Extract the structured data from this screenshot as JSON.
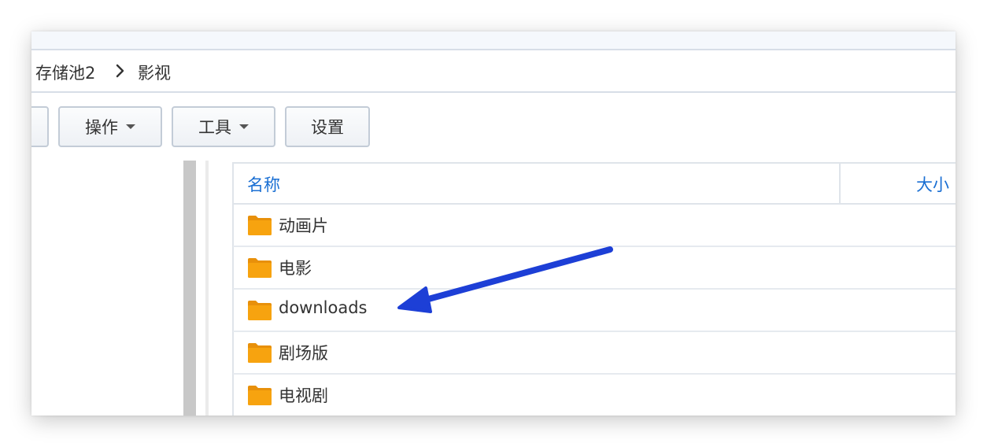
{
  "breadcrumb": {
    "items": [
      "存储池2",
      "影视"
    ]
  },
  "toolbar": {
    "actions_label": "操作",
    "tools_label": "工具",
    "settings_label": "设置"
  },
  "file_list": {
    "columns": {
      "name": "名称",
      "size": "大小"
    },
    "rows": [
      {
        "name": "动画片",
        "type": "folder"
      },
      {
        "name": "电影",
        "type": "folder"
      },
      {
        "name": "downloads",
        "type": "folder"
      },
      {
        "name": "剧场版",
        "type": "folder"
      },
      {
        "name": "电视剧",
        "type": "folder"
      }
    ]
  },
  "icons": {
    "folder": "folder-icon",
    "separator": "chevron-right-icon",
    "dropdown": "caret-down-icon",
    "annotation": "arrow-annotation"
  },
  "colors": {
    "header_text": "#1a6fd3",
    "folder": "#f7a30f",
    "annotation_arrow": "#1d3fd6"
  }
}
